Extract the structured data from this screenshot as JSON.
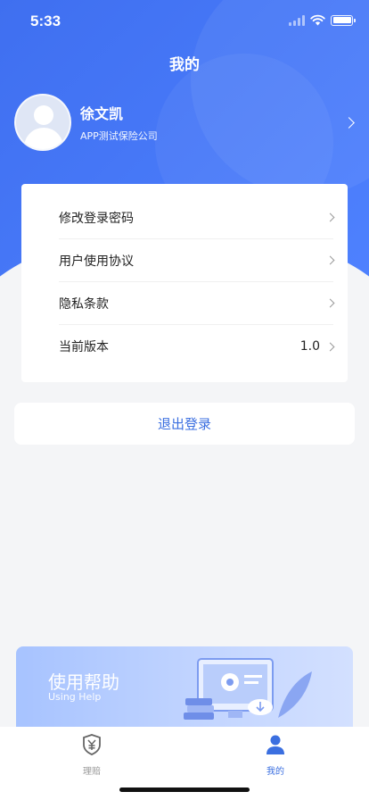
{
  "status": {
    "time": "5:33"
  },
  "header": {
    "title": "我的"
  },
  "profile": {
    "name": "徐文凯",
    "company": "APP测试保险公司"
  },
  "menu": [
    {
      "label": "修改登录密码",
      "value": ""
    },
    {
      "label": "用户使用协议",
      "value": ""
    },
    {
      "label": "隐私条款",
      "value": ""
    },
    {
      "label": "当前版本",
      "value": "1.0"
    }
  ],
  "logout": {
    "label": "退出登录"
  },
  "help": {
    "title": "使用帮助",
    "subtitle": "Using Help"
  },
  "tabs": [
    {
      "label": "理赔",
      "icon": "shield-yen-icon",
      "active": false
    },
    {
      "label": "我的",
      "icon": "person-icon",
      "active": true
    }
  ],
  "colors": {
    "primary": "#4a7bf7",
    "accent_text": "#3b6fe0",
    "background": "#f4f5f7"
  }
}
